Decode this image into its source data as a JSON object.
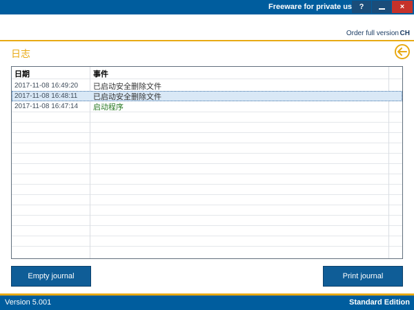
{
  "titlebar": {
    "title": "Freeware for private use",
    "help_label": "?",
    "close_label": "×"
  },
  "subheader": {
    "order_label": "Order full version",
    "language": "CH"
  },
  "page": {
    "heading": "日志"
  },
  "journal": {
    "columns": [
      "日期",
      "事件"
    ],
    "rows": [
      {
        "date": "2017-11-08 16:49:20",
        "event": "已启动安全删除文件"
      },
      {
        "date": "2017-11-08 16:48:11",
        "event": "已启动安全删除文件"
      },
      {
        "date": "2017-11-08 16:47:14",
        "event": "启动程序"
      }
    ],
    "selected_row": 1
  },
  "buttons": {
    "empty": "Empty journal",
    "print": "Print journal"
  },
  "statusbar": {
    "version": "Version 5.001",
    "edition": "Standard Edition"
  },
  "colors": {
    "primary": "#005d9e",
    "accent": "#e8a913",
    "close": "#c6322a",
    "event_start": "#2a7a24"
  }
}
